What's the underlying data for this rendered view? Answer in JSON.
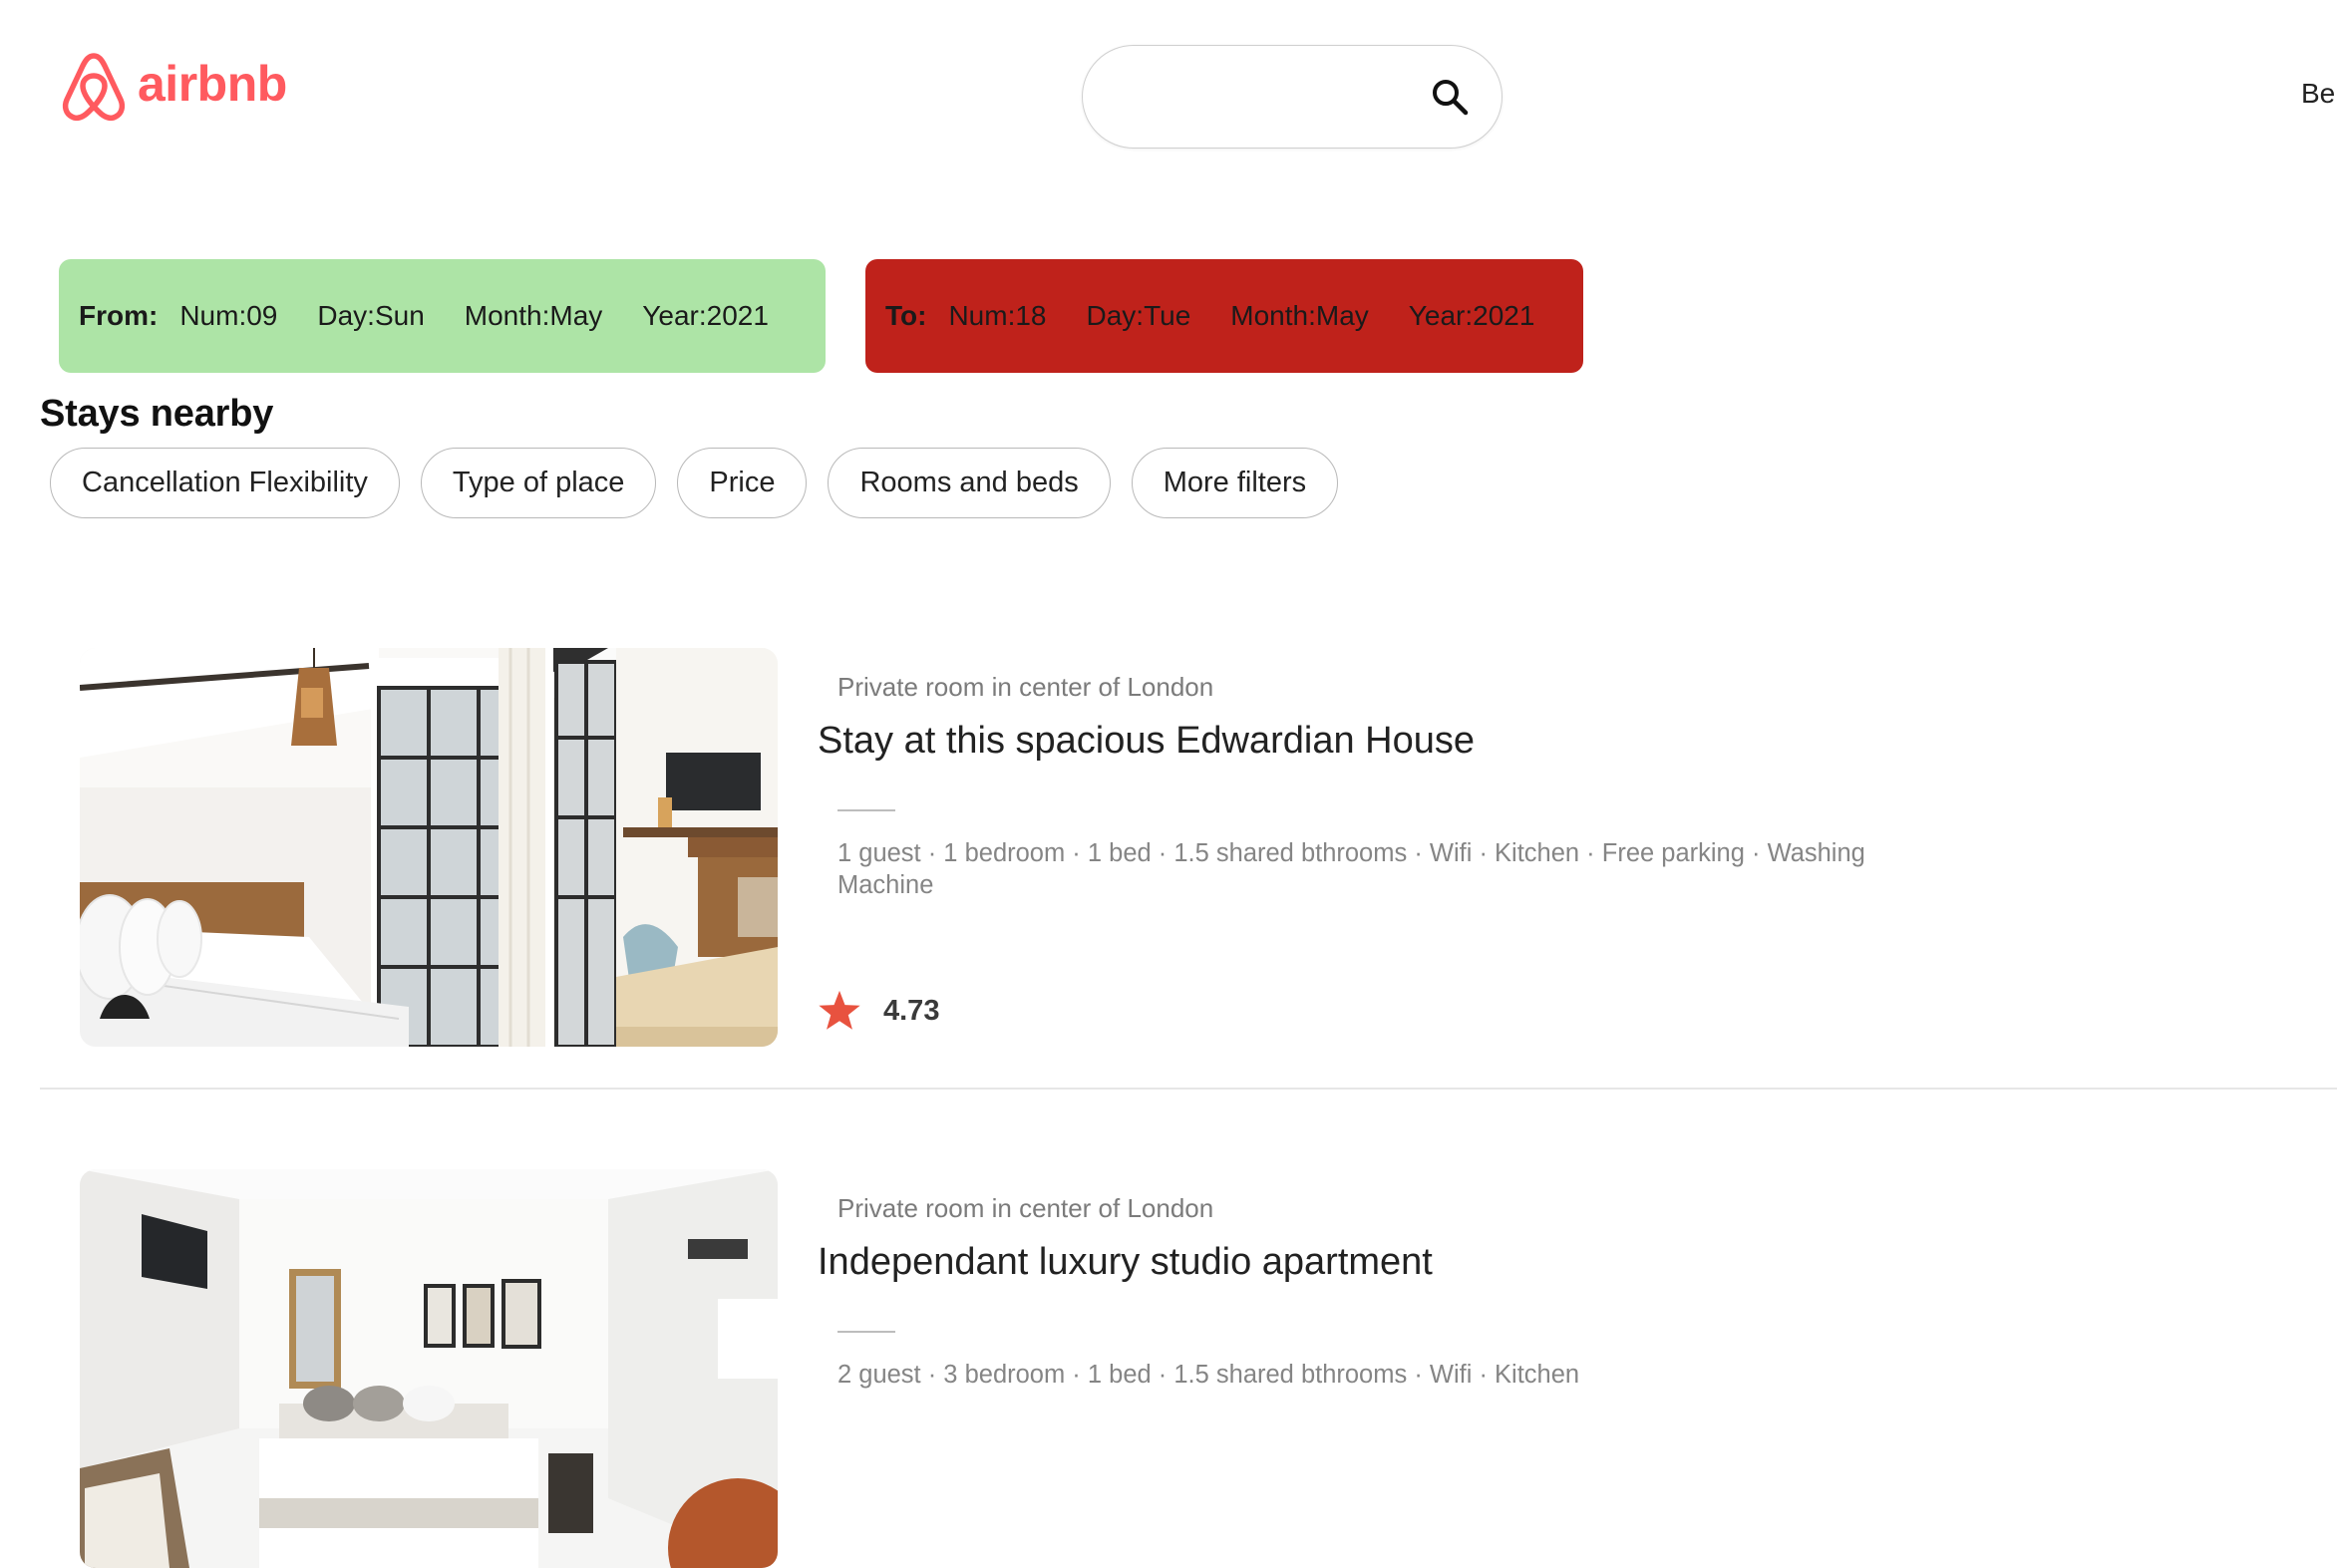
{
  "header": {
    "logo_text": "airbnb",
    "search_placeholder": "",
    "search_icon": "search-icon",
    "right_text": "Be"
  },
  "dates": {
    "from": {
      "label": "From:",
      "num": "Num:09",
      "day": "Day:Sun",
      "month": "Month:May",
      "year": "Year:2021",
      "color": "#ade4a6"
    },
    "to": {
      "label": "To:",
      "num": "Num:18",
      "day": "Day:Tue",
      "month": "Month:May",
      "year": "Year:2021",
      "color": "#bf221b"
    }
  },
  "section_title": "Stays nearby",
  "filters": [
    "Cancellation Flexibility",
    "Type of place",
    "Price",
    "Rooms and beds",
    "More filters"
  ],
  "listings": [
    {
      "subtitle": "Private room in center of London",
      "title": "Stay at this spacious Edwardian House",
      "amenities": "1 guest · 1 bedroom · 1 bed · 1.5 shared bthrooms · Wifi · Kitchen · Free parking · Washing Machine",
      "rating": "4.73",
      "rating_icon": "star-icon"
    },
    {
      "subtitle": "Private room in center of London",
      "title": "Independant luxury studio apartment",
      "amenities": "2 guest · 3 bedroom · 1 bed · 1.5 shared bthrooms · Wifi · Kitchen"
    }
  ],
  "colors": {
    "brand": "#ff5a5f",
    "star": "#e8523f"
  }
}
